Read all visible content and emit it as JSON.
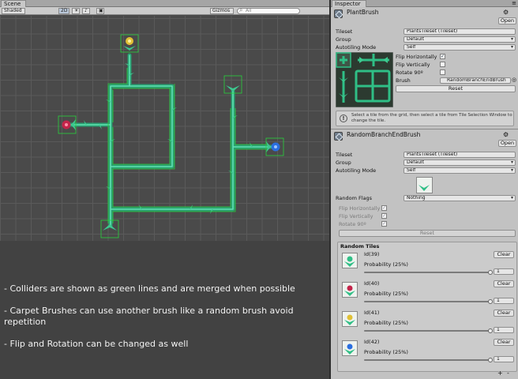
{
  "scene": {
    "tab_label": "Scene",
    "toolbar": {
      "shading": "Shaded",
      "mode_2d": "2D",
      "gizmos": "Gizmos",
      "search_placeholder": "All"
    },
    "notes": [
      "- Colliders are shown as green lines and are merged when possible",
      "- Carpet Brushes can use another brush like a random brush avoid repetition",
      "- Flip and Rotation can be changed as well"
    ],
    "colors": {
      "background": "#4a4a4a",
      "grid": "#5a5a5a",
      "branch": "#2fbf86",
      "collider": "#28d23c",
      "flower_red": "#c3244a",
      "flower_blue": "#2a6fe0",
      "flower_yellow": "#e0c036"
    }
  },
  "inspector": {
    "tab_label": "Inspector",
    "component1": {
      "title": "PlantBrush",
      "open_label": "Open",
      "tileset_label": "Tileset",
      "tileset_value": "PlantsTileset (Tileset)",
      "group_label": "Group",
      "group_value": "Default",
      "autotiling_label": "Autotiling Mode",
      "autotiling_value": "Self",
      "flip_h_label": "Flip Horizontally",
      "flip_v_label": "Flip Vertically",
      "rotate_label": "Rotate 90º",
      "brush_label": "Brush",
      "brush_value": "RandomBranchEndBrush",
      "reset_label": "Reset",
      "info_text": "Select  a tile from the grid, then select a tile from Tile Selection Window to change the tile."
    },
    "component2": {
      "title": "RandomBranchEndBrush",
      "open_label": "Open",
      "tileset_label": "Tileset",
      "tileset_value": "PlantsTileset (Tileset)",
      "group_label": "Group",
      "group_value": "Default",
      "autotiling_label": "Autotiling Mode",
      "autotiling_value": "Self",
      "random_flags_label": "Random Flags",
      "random_flags_value": "Nothing",
      "flip_h_label": "Flip Horizontally",
      "flip_v_label": "Flip Vertically",
      "rotate_label": "Rotate 90º",
      "reset_label": "Reset",
      "random_tiles_label": "Random Tiles",
      "tiles": [
        {
          "id": "Id(39)",
          "probability": "Probability (25%)",
          "weight": "1",
          "clear": "Clear",
          "flower": "#2fbf86"
        },
        {
          "id": "Id(40)",
          "probability": "Probability (25%)",
          "weight": "1",
          "clear": "Clear",
          "flower": "#c3244a"
        },
        {
          "id": "Id(41)",
          "probability": "Probability (25%)",
          "weight": "1",
          "clear": "Clear",
          "flower": "#e0c036"
        },
        {
          "id": "Id(42)",
          "probability": "Probability (25%)",
          "weight": "1",
          "clear": "Clear",
          "flower": "#2a6fe0"
        }
      ],
      "add_label": "+",
      "remove_label": "-"
    }
  }
}
